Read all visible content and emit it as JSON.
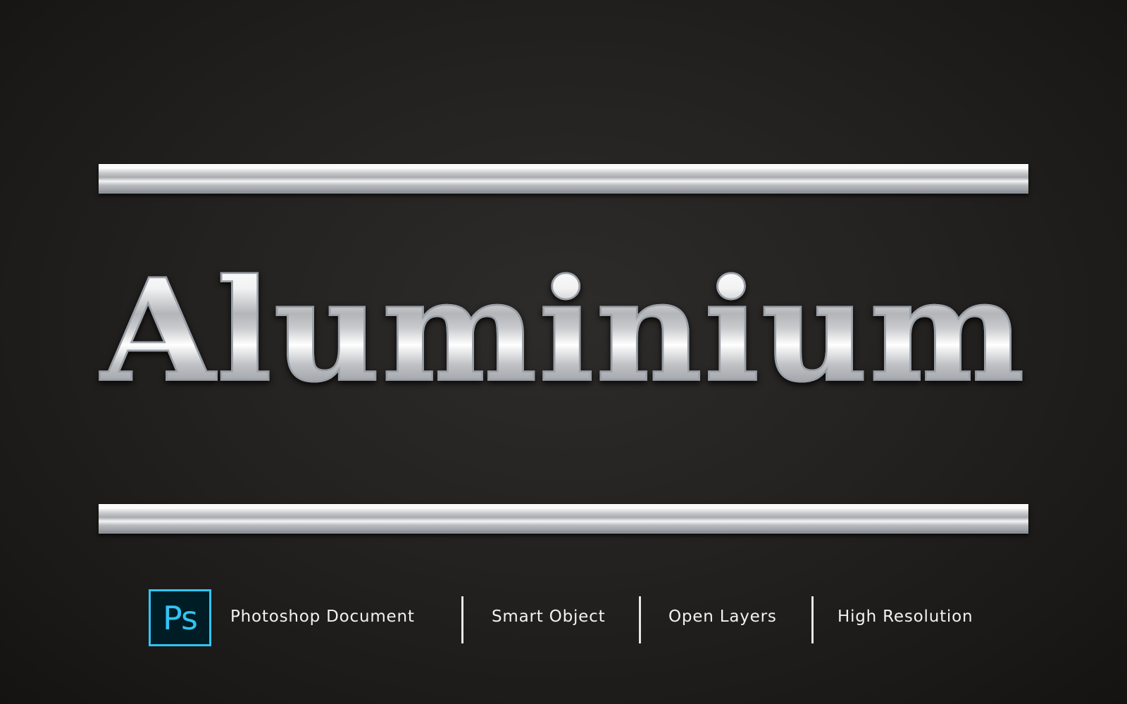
{
  "headline": "Aluminium",
  "logo": {
    "label": "Ps",
    "name": "photoshop-logo",
    "border_color": "#31c5f4",
    "fill_color": "#001d26"
  },
  "features": [
    "Photoshop Document",
    "Smart Object",
    "Open Layers",
    "High Resolution"
  ],
  "colors": {
    "background": "#1e1c1b",
    "text": "#f2f2f2"
  }
}
